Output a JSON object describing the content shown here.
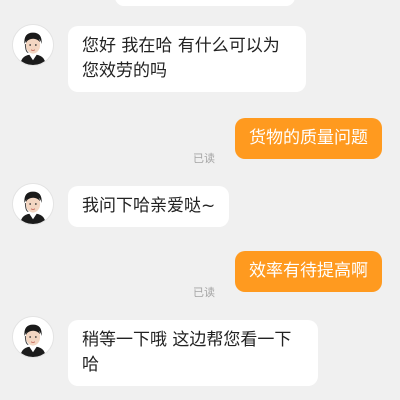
{
  "messages": [
    {
      "side": "in",
      "text": "您好 我在哈 有什么可以为您效劳的吗"
    },
    {
      "side": "out",
      "text": "货物的质量问题",
      "status": "已读"
    },
    {
      "side": "in",
      "text": "我问下哈亲爱哒~"
    },
    {
      "side": "out",
      "text": "效率有待提高啊",
      "status": "已读"
    },
    {
      "side": "in",
      "text": "稍等一下哦 这边帮您看一下哈"
    }
  ],
  "colors": {
    "background": "#f0f0f0",
    "incoming_bubble": "#ffffff",
    "outgoing_bubble": "#ff9a1f",
    "read_status": "#a5a5a5"
  },
  "icons": {
    "agent_avatar": "agent-avatar-icon"
  }
}
